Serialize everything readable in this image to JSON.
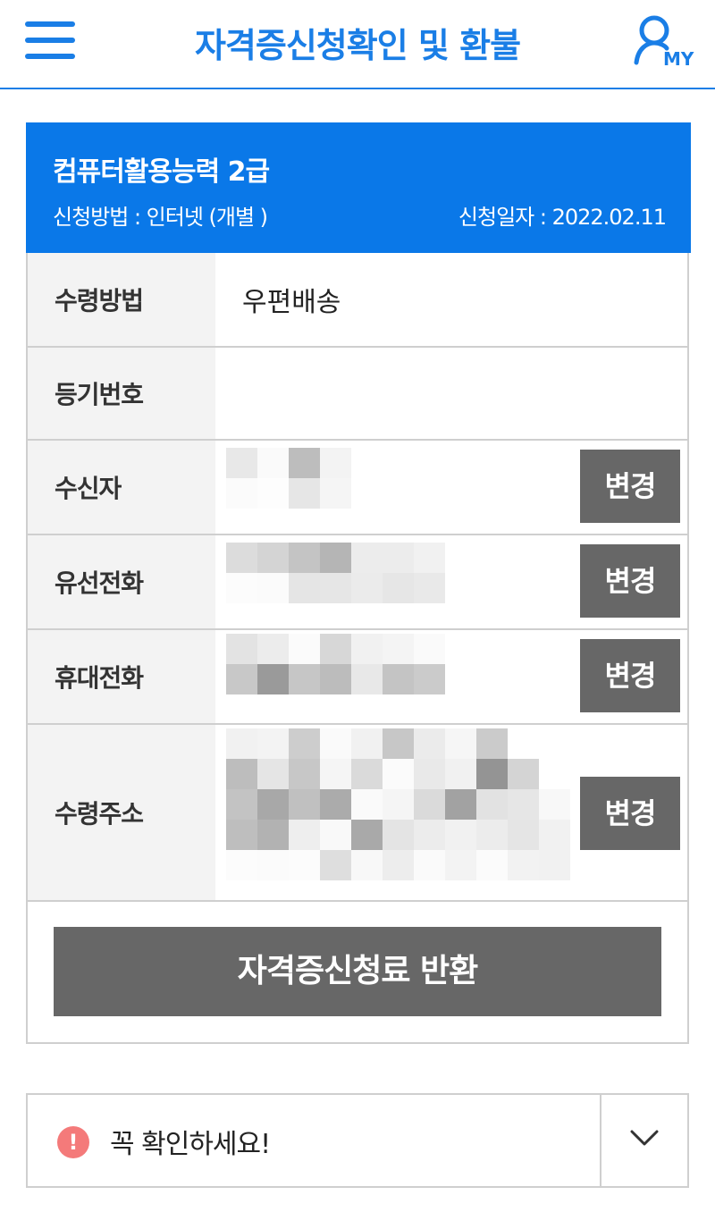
{
  "header": {
    "title": "자격증신청확인 및 환불",
    "my_label": "MY"
  },
  "card": {
    "exam_name": "컴퓨터활용능력 2급",
    "apply_method": "신청방법 : 인터넷 (개별 )",
    "apply_date": "신청일자 : 2022.02.11",
    "rows": [
      {
        "label": "수령방법",
        "value": "우편배송"
      },
      {
        "label": "등기번호",
        "value": ""
      },
      {
        "label": "수신자",
        "value": ""
      },
      {
        "label": "유선전화",
        "value": ""
      },
      {
        "label": "휴대전화",
        "value": ""
      },
      {
        "label": "수령주소",
        "value": ""
      }
    ],
    "change_label": "변경",
    "refund_label": "자격증신청료 반환"
  },
  "notice": {
    "icon": "!",
    "text": "꼭 확인하세요!"
  },
  "colors": {
    "brand": "#1a7ee6",
    "card_header": "#0a78e8",
    "button_gray": "#676767",
    "alert": "#f47a7a"
  },
  "icons": {
    "menu": "hamburger-icon",
    "my": "user-icon",
    "alert": "exclamation-icon",
    "toggle": "chevron-down-icon"
  }
}
